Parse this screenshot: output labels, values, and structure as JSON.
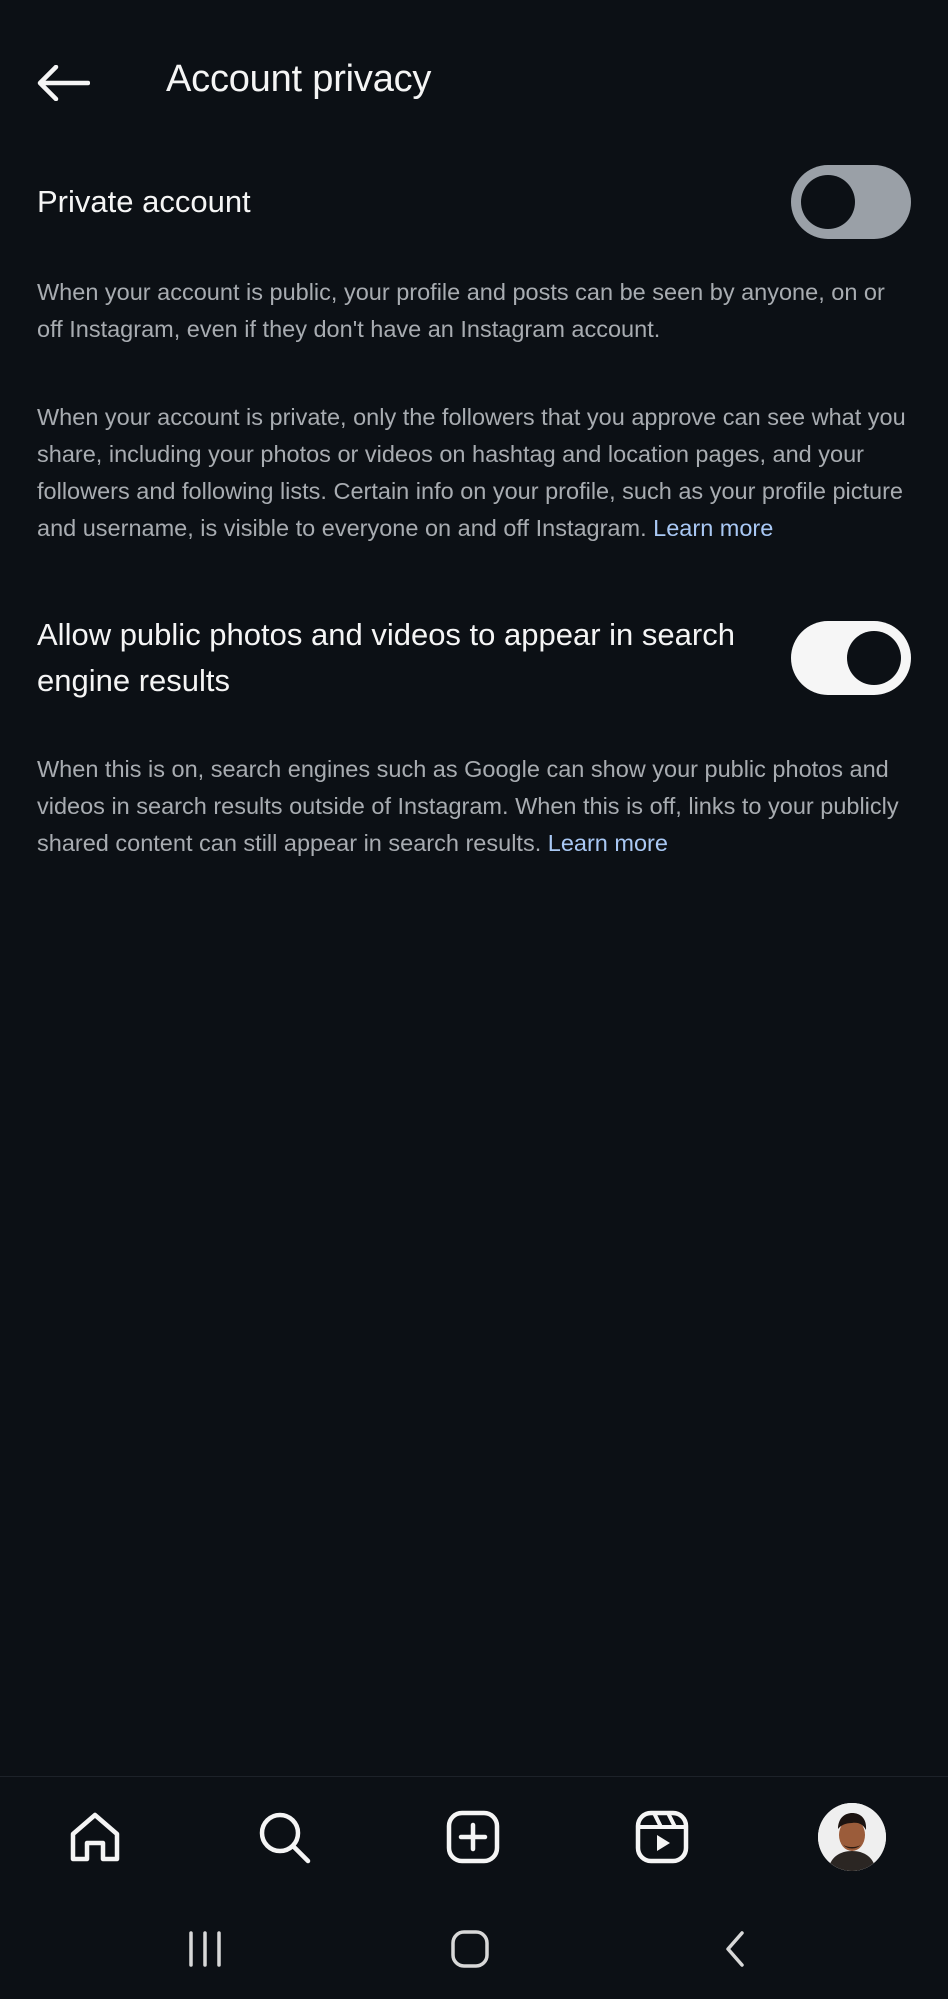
{
  "header": {
    "title": "Account privacy",
    "back_icon": "arrow-left-icon"
  },
  "private_account": {
    "label": "Private account",
    "enabled": false
  },
  "descriptions": {
    "public": "When your account is public, your profile and posts can be seen by anyone, on or off Instagram, even if they don't have an Instagram account.",
    "private_text": "When your account is private, only the followers that you approve can see what you share, including your photos or videos on hashtag and location pages, and your followers and following lists. Certain info on your profile, such as your profile picture and username, is visible to everyone on and off Instagram.",
    "private_link": "Learn more"
  },
  "search_engine": {
    "label": "Allow public photos and videos to appear in search engine results",
    "enabled": true,
    "description": "When this is on, search engines such as Google can show your public photos and videos in search results outside of Instagram. When this is off, links to your publicly shared content can still appear in search results.",
    "link": "Learn more"
  },
  "bottom_nav": {
    "items": [
      {
        "icon": "home-icon"
      },
      {
        "icon": "search-icon"
      },
      {
        "icon": "create-icon"
      },
      {
        "icon": "reels-icon"
      },
      {
        "icon": "profile-avatar"
      }
    ]
  },
  "system_nav": {
    "items": [
      {
        "icon": "recent-apps-icon"
      },
      {
        "icon": "home-circle-icon"
      },
      {
        "icon": "back-chevron-icon"
      }
    ]
  },
  "colors": {
    "background": "#0c1015",
    "text": "#f5f5f5",
    "secondary_text": "#a8acb1",
    "link": "#a9c8f4",
    "toggle_off": "#9aa0a7",
    "toggle_on": "#f6f6f6"
  }
}
